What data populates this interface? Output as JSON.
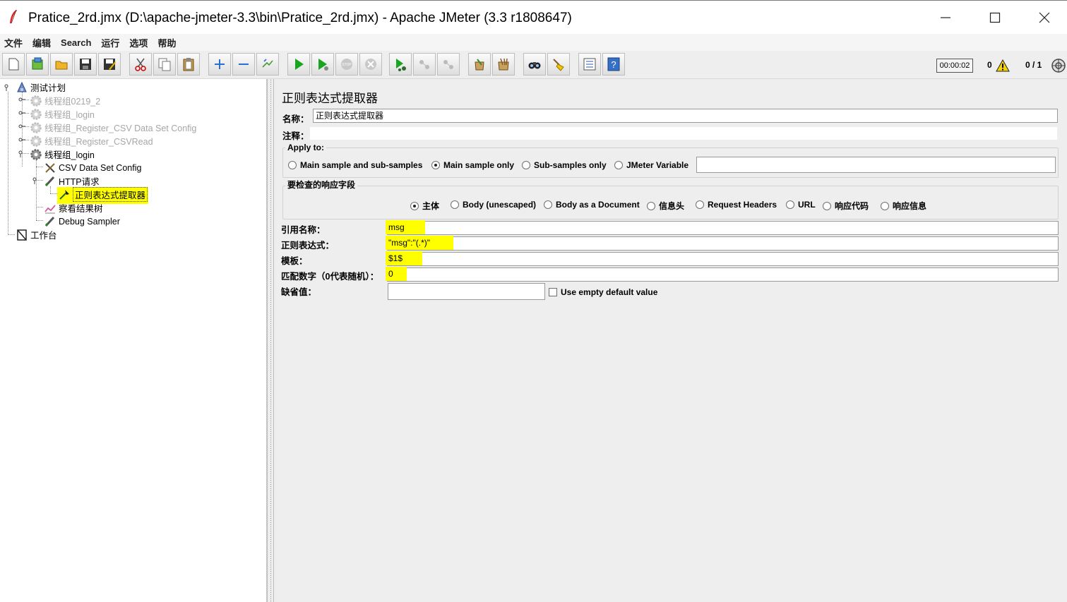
{
  "window": {
    "title": "Pratice_2rd.jmx (D:\\apache-jmeter-3.3\\bin\\Pratice_2rd.jmx) - Apache JMeter (3.3 r1808647)"
  },
  "menu": [
    "文件",
    "编辑",
    "Search",
    "运行",
    "选项",
    "帮助"
  ],
  "toolbar": {
    "timer": "00:00:02",
    "warning_count": "0",
    "threads": "0 / 1",
    "buttons": [
      "new-icon",
      "templates-icon",
      "open-icon",
      "save-icon",
      "save-as-icon",
      "cut-icon",
      "copy-icon",
      "paste-icon",
      "expand-icon",
      "collapse-icon",
      "toggle-icon",
      "start-icon",
      "start-no-pause-icon",
      "stop-icon",
      "shutdown-icon",
      "remote-start-icon",
      "remote-stop-icon",
      "remote-shutdown-icon",
      "clear-icon",
      "clear-all-icon",
      "search-icon",
      "reset-search-icon",
      "function-helper-icon",
      "help-icon"
    ]
  },
  "tree": {
    "nodes": [
      {
        "label": "测试计划",
        "icon": "test-plan-icon",
        "disabled": false
      },
      {
        "label": "线程组0219_2",
        "icon": "thread-group-icon",
        "disabled": true
      },
      {
        "label": "线程组_login",
        "icon": "thread-group-icon",
        "disabled": true
      },
      {
        "label": "线程组_Register_CSV Data Set Config",
        "icon": "thread-group-icon",
        "disabled": true
      },
      {
        "label": "线程组_Register_CSVRead",
        "icon": "thread-group-icon",
        "disabled": true
      },
      {
        "label": "线程组_login",
        "icon": "thread-group-icon",
        "disabled": false
      },
      {
        "label": "CSV Data Set Config",
        "icon": "config-element-icon",
        "disabled": false
      },
      {
        "label": "HTTP请求",
        "icon": "sampler-icon",
        "disabled": false
      },
      {
        "label": "正则表达式提取器",
        "icon": "post-processor-icon",
        "disabled": false,
        "selected": true
      },
      {
        "label": "察看结果树",
        "icon": "listener-icon",
        "disabled": false
      },
      {
        "label": "Debug Sampler",
        "icon": "sampler-icon",
        "disabled": false
      },
      {
        "label": "工作台",
        "icon": "workbench-icon",
        "disabled": false
      }
    ]
  },
  "panel": {
    "title": "正则表达式提取器",
    "name_label": "名称：",
    "name_value": "正则表达式提取器",
    "comment_label": "注释：",
    "comment_value": "",
    "apply_to": {
      "title": "Apply to:",
      "options": [
        "Main sample and sub-samples",
        "Main sample only",
        "Sub-samples only",
        "JMeter Variable"
      ],
      "selected": "Main sample only",
      "variable_value": ""
    },
    "field_to_check": {
      "title": "要检查的响应字段",
      "options": [
        "主体",
        "Body (unescaped)",
        "Body as a Document",
        "信息头",
        "Request Headers",
        "URL",
        "响应代码",
        "响应信息"
      ],
      "selected": "主体"
    },
    "ref_name_label": "引用名称：",
    "ref_name_value": "msg",
    "regex_label": "正则表达式：",
    "regex_value": "\"msg\":\"(.*)\"",
    "template_label": "模板：",
    "template_value": "$1$",
    "match_no_label": "匹配数字（0代表随机）：",
    "match_no_value": "0",
    "default_label": "缺省值：",
    "default_value": "",
    "use_empty_default_label": "Use empty default value",
    "use_empty_default_checked": false
  }
}
